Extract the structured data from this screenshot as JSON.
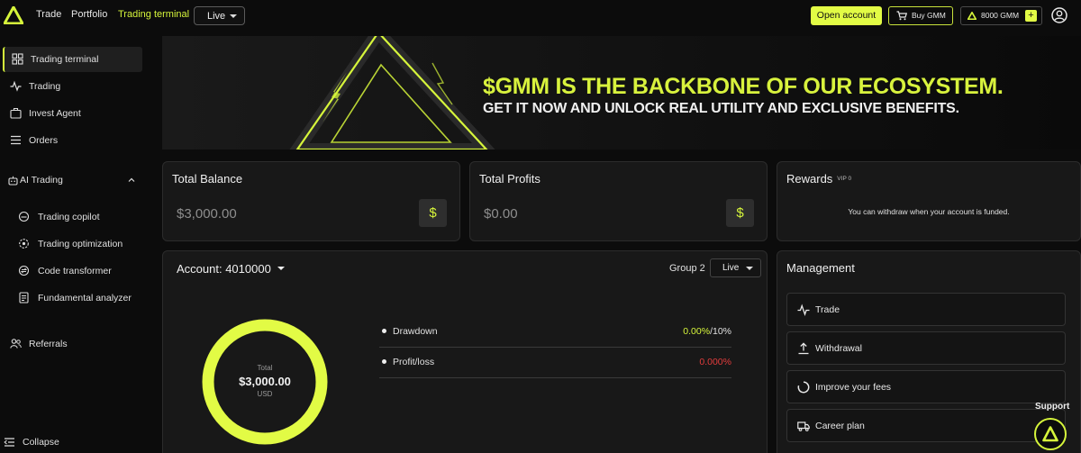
{
  "nav": {
    "links": [
      "Trade",
      "Portfolio",
      "Trading terminal"
    ],
    "mode_select": "Live",
    "open_account": "Open account",
    "buy_gmm": "Buy GMM",
    "gmm_balance": "8000 GMM",
    "plus": "+"
  },
  "sidebar": {
    "items": [
      "Trading terminal",
      "Trading",
      "Invest Agent",
      "Orders"
    ],
    "section": "AI Trading",
    "sub_items": [
      "Trading copilot",
      "Trading optimization",
      "Code transformer",
      "Fundamental analyzer"
    ],
    "referrals": "Referrals",
    "collapse": "Collapse"
  },
  "banner": {
    "title": "$GMM IS THE BACKBONE OF OUR ECOSYSTEM.",
    "subtitle": "GET IT NOW AND UNLOCK REAL UTILITY AND EXCLUSIVE BENEFITS."
  },
  "total_balance": {
    "title": "Total Balance",
    "value": "$3,000.00",
    "icon": "$"
  },
  "total_profits": {
    "title": "Total Profits",
    "value": "$0.00",
    "icon": "$"
  },
  "rewards": {
    "title": "Rewards",
    "vip": "VIP 0",
    "note": "You can withdraw when your account is funded."
  },
  "account": {
    "title": "Account: 4010000",
    "group": "Group 2",
    "mode": "Live",
    "donut": {
      "label": "Total",
      "value": "$3,000.00",
      "currency": "USD"
    },
    "stats": [
      {
        "label": "Drawdown",
        "value": "0.00%",
        "limit": "/10%"
      },
      {
        "label": "Profit/loss",
        "value": "0.000%"
      }
    ]
  },
  "management": {
    "title": "Management",
    "items": [
      "Trade",
      "Withdrawal",
      "Improve your fees",
      "Career plan"
    ]
  },
  "support": "Support",
  "colors": {
    "accent": "#d6f53b",
    "negative": "#e23c3c",
    "background": "#0c0c0c",
    "card": "#181818"
  }
}
